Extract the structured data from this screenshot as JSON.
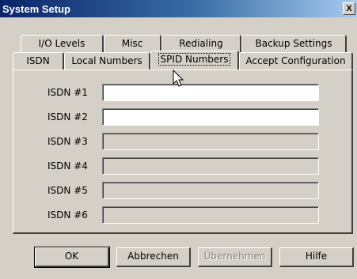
{
  "window": {
    "title": "System Setup",
    "close_label": "X"
  },
  "tabs_back": [
    {
      "label": "I/O Levels"
    },
    {
      "label": "Misc"
    },
    {
      "label": "Redialing"
    },
    {
      "label": "Backup Settings"
    }
  ],
  "tabs_front": [
    {
      "label": "ISDN"
    },
    {
      "label": "Local Numbers"
    },
    {
      "label": "SPID Numbers",
      "active": true
    },
    {
      "label": "Accept Configuration"
    }
  ],
  "fields": [
    {
      "label": "ISDN #1",
      "value": "",
      "enabled": true
    },
    {
      "label": "ISDN #2",
      "value": "",
      "enabled": true
    },
    {
      "label": "ISDN #3",
      "value": "",
      "enabled": false
    },
    {
      "label": "ISDN #4",
      "value": "",
      "enabled": false
    },
    {
      "label": "ISDN #5",
      "value": "",
      "enabled": false
    },
    {
      "label": "ISDN #6",
      "value": "",
      "enabled": false
    }
  ],
  "buttons": {
    "ok": "OK",
    "cancel": "Abbrechen",
    "apply": "Übernehmen",
    "help": "Hilfe"
  },
  "colors": {
    "face": "#d4d0c8",
    "title_start": "#0a246a",
    "title_end": "#a6caf0"
  }
}
